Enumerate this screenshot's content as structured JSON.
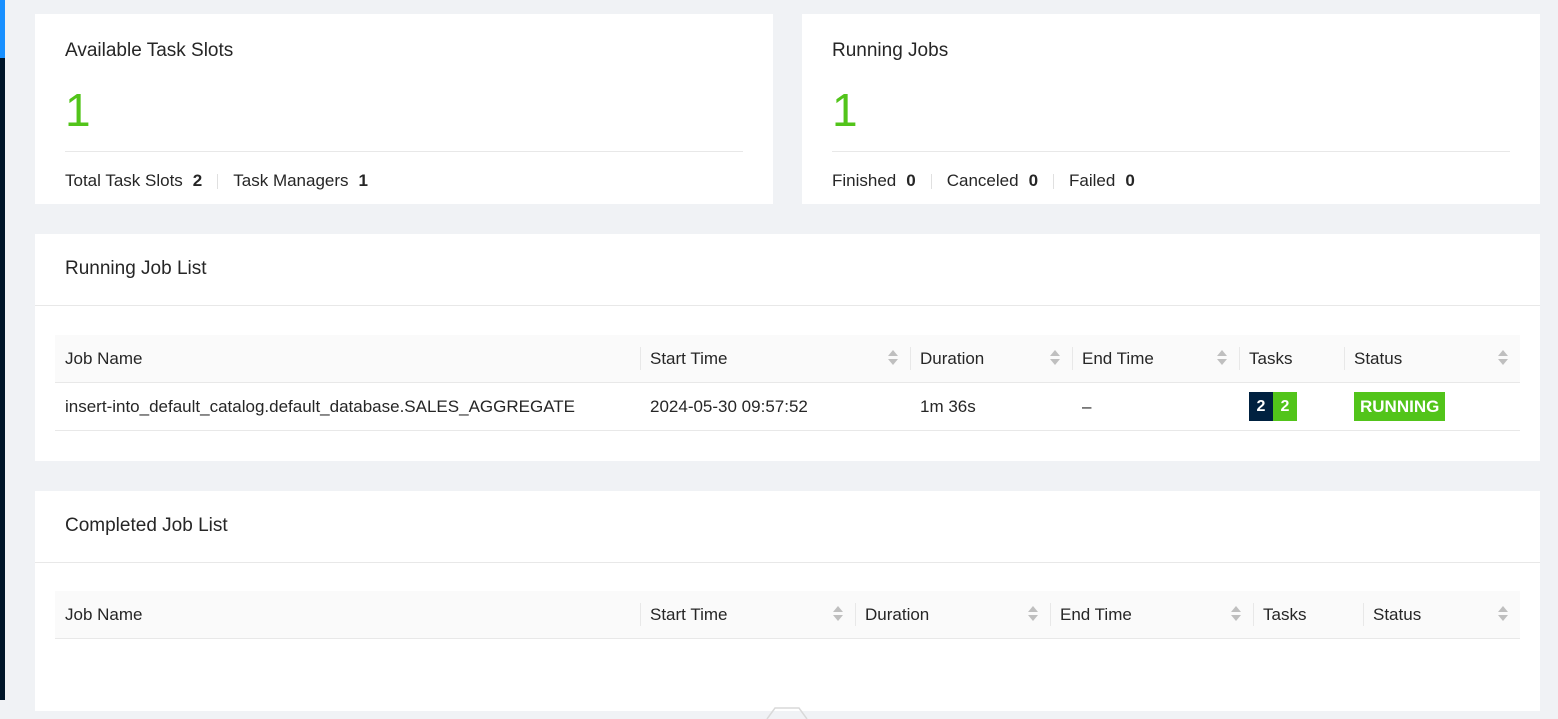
{
  "colors": {
    "accent_green": "#52c41a",
    "navy": "#002140",
    "rail": "#001529",
    "rail_active": "#1890ff"
  },
  "slots_card": {
    "title": "Available Task Slots",
    "value": "1",
    "total_label": "Total Task Slots",
    "total_value": "2",
    "managers_label": "Task Managers",
    "managers_value": "1"
  },
  "jobs_card": {
    "title": "Running Jobs",
    "value": "1",
    "finished_label": "Finished",
    "finished_value": "0",
    "canceled_label": "Canceled",
    "canceled_value": "0",
    "failed_label": "Failed",
    "failed_value": "0"
  },
  "running_list": {
    "title": "Running Job List",
    "columns": [
      "Job Name",
      "Start Time",
      "Duration",
      "End Time",
      "Tasks",
      "Status"
    ],
    "rows": [
      {
        "job_name": "insert-into_default_catalog.default_database.SALES_AGGREGATE",
        "start_time": "2024-05-30 09:57:52",
        "duration": "1m 36s",
        "end_time": "–",
        "tasks_total": "2",
        "tasks_running": "2",
        "status": "RUNNING"
      }
    ]
  },
  "completed_list": {
    "title": "Completed Job List",
    "columns": [
      "Job Name",
      "Start Time",
      "Duration",
      "End Time",
      "Tasks",
      "Status"
    ],
    "rows": []
  },
  "icons": {
    "sort": "sort-caret-icon",
    "empty": "empty-state-icon"
  }
}
